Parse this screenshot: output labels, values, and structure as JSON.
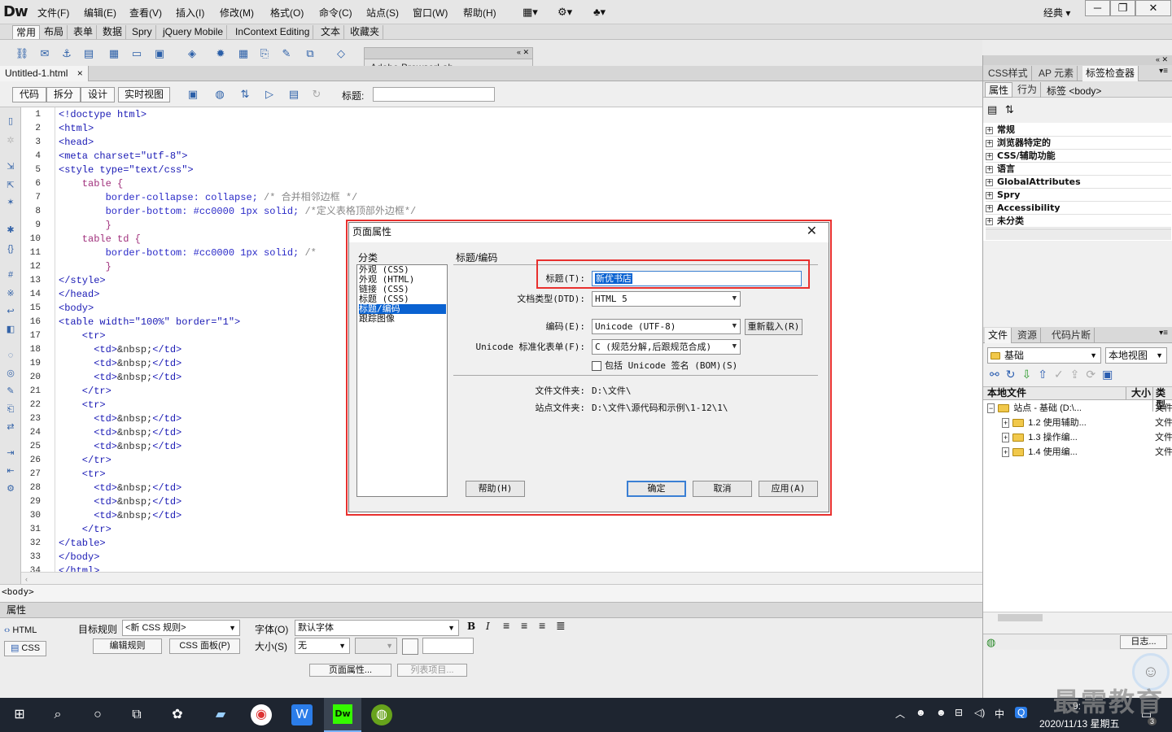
{
  "app": {
    "logo": "Dw",
    "workspace": "经典"
  },
  "menu": [
    "文件(F)",
    "编辑(E)",
    "查看(V)",
    "插入(I)",
    "修改(M)",
    "格式(O)",
    "命令(C)",
    "站点(S)",
    "窗口(W)",
    "帮助(H)"
  ],
  "insert_tabs": [
    "常用",
    "布局",
    "表单",
    "数据",
    "Spry",
    "jQuery Mobile",
    "InContext Editing",
    "文本",
    "收藏夹"
  ],
  "browserlab": {
    "title": "Adobe BrowserLab"
  },
  "document": {
    "tab": "Untitled-1.html",
    "close": "×"
  },
  "view_buttons": {
    "code": "代码",
    "split": "拆分",
    "design": "设计",
    "live": "实时视图",
    "title_label": "标题:"
  },
  "code_lines": [
    [
      {
        "t": "<!doctype html>",
        "c": "tag"
      }
    ],
    [
      {
        "t": "<html>",
        "c": "tag"
      }
    ],
    [
      {
        "t": "<head>",
        "c": "tag"
      }
    ],
    [
      {
        "t": "<meta charset=\"utf-8\">",
        "c": "tag"
      }
    ],
    [
      {
        "t": "<style type=\"text/css\">",
        "c": "tag"
      }
    ],
    [
      {
        "t": "    table {",
        "c": "sel"
      }
    ],
    [
      {
        "t": "        border-collapse: collapse; ",
        "c": "prop"
      },
      {
        "t": "/* 合并相邻边框 */",
        "c": "cmt"
      }
    ],
    [
      {
        "t": "        border-bottom: #cc0000 1px solid; ",
        "c": "prop"
      },
      {
        "t": "/*定义表格顶部外边框*/",
        "c": "cmt"
      }
    ],
    [
      {
        "t": "        }",
        "c": "sel"
      }
    ],
    [
      {
        "t": "    table td {",
        "c": "sel"
      }
    ],
    [
      {
        "t": "        border-bottom: #cc0000 1px solid; ",
        "c": "prop"
      },
      {
        "t": "/*",
        "c": "cmt"
      }
    ],
    [
      {
        "t": "        }",
        "c": "sel"
      }
    ],
    [
      {
        "t": "</style>",
        "c": "tag"
      }
    ],
    [
      {
        "t": "</head>",
        "c": "tag"
      }
    ],
    [
      {
        "t": "<body>",
        "c": "tag"
      }
    ],
    [
      {
        "t": "<table width=\"100%\" border=\"1\">",
        "c": "tag"
      }
    ],
    [
      {
        "t": "    <tr>",
        "c": "tag"
      }
    ],
    [
      {
        "t": "      <td>",
        "c": "tag"
      },
      {
        "t": "&nbsp;",
        "c": "ent"
      },
      {
        "t": "</td>",
        "c": "tag"
      }
    ],
    [
      {
        "t": "      <td>",
        "c": "tag"
      },
      {
        "t": "&nbsp;",
        "c": "ent"
      },
      {
        "t": "</td>",
        "c": "tag"
      }
    ],
    [
      {
        "t": "      <td>",
        "c": "tag"
      },
      {
        "t": "&nbsp;",
        "c": "ent"
      },
      {
        "t": "</td>",
        "c": "tag"
      }
    ],
    [
      {
        "t": "    </tr>",
        "c": "tag"
      }
    ],
    [
      {
        "t": "    <tr>",
        "c": "tag"
      }
    ],
    [
      {
        "t": "      <td>",
        "c": "tag"
      },
      {
        "t": "&nbsp;",
        "c": "ent"
      },
      {
        "t": "</td>",
        "c": "tag"
      }
    ],
    [
      {
        "t": "      <td>",
        "c": "tag"
      },
      {
        "t": "&nbsp;",
        "c": "ent"
      },
      {
        "t": "</td>",
        "c": "tag"
      }
    ],
    [
      {
        "t": "      <td>",
        "c": "tag"
      },
      {
        "t": "&nbsp;",
        "c": "ent"
      },
      {
        "t": "</td>",
        "c": "tag"
      }
    ],
    [
      {
        "t": "    </tr>",
        "c": "tag"
      }
    ],
    [
      {
        "t": "    <tr>",
        "c": "tag"
      }
    ],
    [
      {
        "t": "      <td>",
        "c": "tag"
      },
      {
        "t": "&nbsp;",
        "c": "ent"
      },
      {
        "t": "</td>",
        "c": "tag"
      }
    ],
    [
      {
        "t": "      <td>",
        "c": "tag"
      },
      {
        "t": "&nbsp;",
        "c": "ent"
      },
      {
        "t": "</td>",
        "c": "tag"
      }
    ],
    [
      {
        "t": "      <td>",
        "c": "tag"
      },
      {
        "t": "&nbsp;",
        "c": "ent"
      },
      {
        "t": "</td>",
        "c": "tag"
      }
    ],
    [
      {
        "t": "    </tr>",
        "c": "tag"
      }
    ],
    [
      {
        "t": "</table>",
        "c": "tag"
      }
    ],
    [
      {
        "t": "</body>",
        "c": "tag"
      }
    ],
    [
      {
        "t": "</html>",
        "c": "tag"
      }
    ]
  ],
  "status": {
    "tag": "<body>"
  },
  "properties": {
    "header": "属性",
    "html_btn": "HTML",
    "css_btn": "CSS",
    "target_rule_label": "目标规则",
    "target_rule_value": "<新 CSS 规则>",
    "edit_rule": "编辑规则",
    "css_panel": "CSS 面板(P)",
    "font_label": "字体(O)",
    "font_value": "默认字体",
    "size_label": "大小(S)",
    "size_value": "无",
    "bold": "B",
    "italic": "I",
    "page_props": "页面属性...",
    "list_item": "列表项目..."
  },
  "right_panel": {
    "top_tabs": [
      "CSS样式",
      "AP 元素",
      "标签检查器"
    ],
    "sub_tabs": [
      "属性",
      "行为"
    ],
    "tag_label": "标签 <body>",
    "categories": [
      "常规",
      "浏览器特定的",
      "CSS/辅助功能",
      "语言",
      "GlobalAttributes",
      "Spry",
      "Accessibility",
      "未分类"
    ],
    "file_tabs": [
      "文件",
      "资源",
      "代码片断"
    ],
    "site_select": "基础",
    "view_select": "本地视图",
    "col_local": "本地文件",
    "col_size": "大小",
    "col_type": "类型",
    "site_root": "站点 - 基础 (D:\\...",
    "site_root_type": "文件",
    "files": [
      {
        "name": "1.2 使用辅助...",
        "type": "文件"
      },
      {
        "name": "1.3  操作编...",
        "type": "文件"
      },
      {
        "name": "1.4  使用编...",
        "type": "文件"
      }
    ],
    "log": "日志..."
  },
  "dialog": {
    "title": "页面属性",
    "close": "✕",
    "category_label": "分类",
    "categories": [
      "外观 (CSS)",
      "外观 (HTML)",
      "链接 (CSS)",
      "标题 (CSS)",
      "标题/编码",
      "跟踪图像"
    ],
    "selected_category": 4,
    "section": "标题/编码",
    "title_label": "标题(T):",
    "title_value": "新优书店",
    "dtd_label": "文档类型(DTD):",
    "dtd_value": "HTML 5",
    "encoding_label": "编码(E):",
    "encoding_value": "Unicode (UTF-8)",
    "reload": "重新载入(R)",
    "unicode_label": "Unicode 标准化表单(F):",
    "unicode_value": "C (规范分解,后跟规范合成)",
    "bom": "包括 Unicode 签名 (BOM)(S)",
    "doc_folder_label": "文件文件夹:",
    "doc_folder_value": "D:\\文件\\",
    "site_folder_label": "站点文件夹:",
    "site_folder_value": "D:\\文件\\源代码和示例\\1-12\\1\\",
    "help": "帮助(H)",
    "ok": "确定",
    "cancel": "取消",
    "apply": "应用(A)"
  },
  "taskbar": {
    "ime": "中",
    "date": "2020/11/13 星期五",
    "time": "9:",
    "badge": "3"
  },
  "watermark": "最需教育",
  "colors": {
    "highlight": "#e8302e",
    "selection": "#0a62d1",
    "taskbar": "#1e2530"
  }
}
